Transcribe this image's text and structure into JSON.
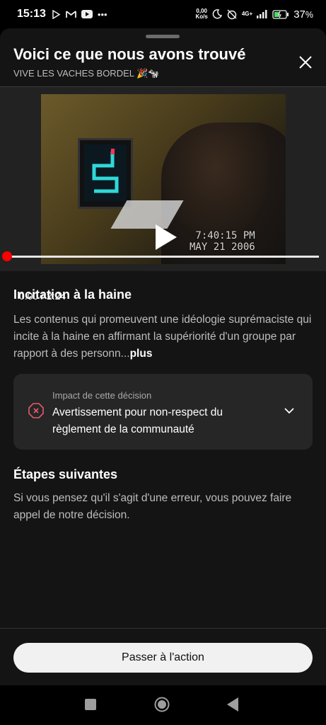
{
  "status_bar": {
    "time": "15:13",
    "net_speed_top": "0,00",
    "net_speed_bottom": "Ko/s",
    "network": "4G+",
    "battery_pct": "37",
    "battery_unit": "%"
  },
  "sheet": {
    "title": "Voici ce que nous avons trouvé",
    "subtitle": "VIVE LES VACHES BORDEL 🎉🐄"
  },
  "video": {
    "current_time": "0:00",
    "separator": " / ",
    "duration": "2:24",
    "progress": 0,
    "overlay_time": "7:40:15 PM",
    "overlay_date": "MAY 21 2006"
  },
  "violation": {
    "title": "Incitation à la haine",
    "description": "Les contenus qui promeuvent une idéologie suprémaciste qui incite à la haine en affirmant la supériorité d'un groupe par rapport à des personn...",
    "more_label": "plus"
  },
  "impact_card": {
    "label": "Impact de cette décision",
    "value": "Avertissement pour non-respect du règlement de la communauté"
  },
  "next_steps": {
    "title": "Étapes suivantes",
    "body": "Si vous pensez qu'il s'agit d'une erreur, vous pouvez faire appel de notre décision."
  },
  "action_button": {
    "label": "Passer à l'action"
  },
  "colors": {
    "sheet_bg": "#141414",
    "card_bg": "#262626",
    "accent_red": "#ff0000",
    "warning_icon": "#e05a6e"
  }
}
